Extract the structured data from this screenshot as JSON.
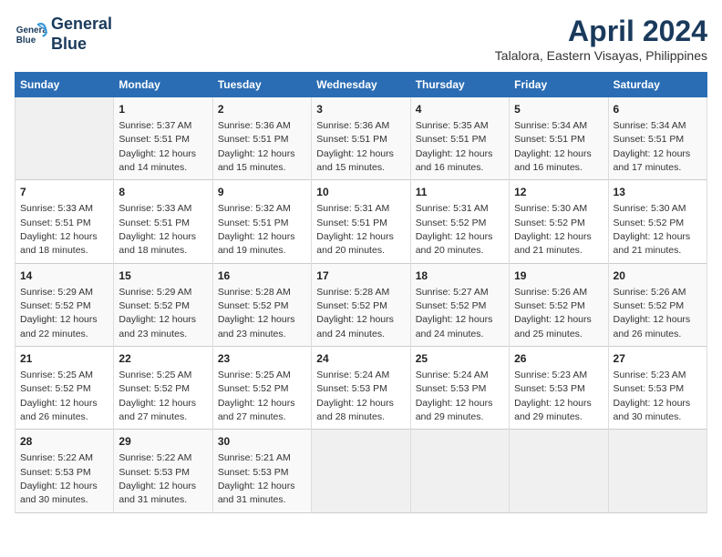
{
  "header": {
    "logo_line1": "General",
    "logo_line2": "Blue",
    "title": "April 2024",
    "subtitle": "Talalora, Eastern Visayas, Philippines"
  },
  "days_of_week": [
    "Sunday",
    "Monday",
    "Tuesday",
    "Wednesday",
    "Thursday",
    "Friday",
    "Saturday"
  ],
  "weeks": [
    [
      {
        "day": "",
        "info": ""
      },
      {
        "day": "1",
        "info": "Sunrise: 5:37 AM\nSunset: 5:51 PM\nDaylight: 12 hours\nand 14 minutes."
      },
      {
        "day": "2",
        "info": "Sunrise: 5:36 AM\nSunset: 5:51 PM\nDaylight: 12 hours\nand 15 minutes."
      },
      {
        "day": "3",
        "info": "Sunrise: 5:36 AM\nSunset: 5:51 PM\nDaylight: 12 hours\nand 15 minutes."
      },
      {
        "day": "4",
        "info": "Sunrise: 5:35 AM\nSunset: 5:51 PM\nDaylight: 12 hours\nand 16 minutes."
      },
      {
        "day": "5",
        "info": "Sunrise: 5:34 AM\nSunset: 5:51 PM\nDaylight: 12 hours\nand 16 minutes."
      },
      {
        "day": "6",
        "info": "Sunrise: 5:34 AM\nSunset: 5:51 PM\nDaylight: 12 hours\nand 17 minutes."
      }
    ],
    [
      {
        "day": "7",
        "info": "Sunrise: 5:33 AM\nSunset: 5:51 PM\nDaylight: 12 hours\nand 18 minutes."
      },
      {
        "day": "8",
        "info": "Sunrise: 5:33 AM\nSunset: 5:51 PM\nDaylight: 12 hours\nand 18 minutes."
      },
      {
        "day": "9",
        "info": "Sunrise: 5:32 AM\nSunset: 5:51 PM\nDaylight: 12 hours\nand 19 minutes."
      },
      {
        "day": "10",
        "info": "Sunrise: 5:31 AM\nSunset: 5:51 PM\nDaylight: 12 hours\nand 20 minutes."
      },
      {
        "day": "11",
        "info": "Sunrise: 5:31 AM\nSunset: 5:52 PM\nDaylight: 12 hours\nand 20 minutes."
      },
      {
        "day": "12",
        "info": "Sunrise: 5:30 AM\nSunset: 5:52 PM\nDaylight: 12 hours\nand 21 minutes."
      },
      {
        "day": "13",
        "info": "Sunrise: 5:30 AM\nSunset: 5:52 PM\nDaylight: 12 hours\nand 21 minutes."
      }
    ],
    [
      {
        "day": "14",
        "info": "Sunrise: 5:29 AM\nSunset: 5:52 PM\nDaylight: 12 hours\nand 22 minutes."
      },
      {
        "day": "15",
        "info": "Sunrise: 5:29 AM\nSunset: 5:52 PM\nDaylight: 12 hours\nand 23 minutes."
      },
      {
        "day": "16",
        "info": "Sunrise: 5:28 AM\nSunset: 5:52 PM\nDaylight: 12 hours\nand 23 minutes."
      },
      {
        "day": "17",
        "info": "Sunrise: 5:28 AM\nSunset: 5:52 PM\nDaylight: 12 hours\nand 24 minutes."
      },
      {
        "day": "18",
        "info": "Sunrise: 5:27 AM\nSunset: 5:52 PM\nDaylight: 12 hours\nand 24 minutes."
      },
      {
        "day": "19",
        "info": "Sunrise: 5:26 AM\nSunset: 5:52 PM\nDaylight: 12 hours\nand 25 minutes."
      },
      {
        "day": "20",
        "info": "Sunrise: 5:26 AM\nSunset: 5:52 PM\nDaylight: 12 hours\nand 26 minutes."
      }
    ],
    [
      {
        "day": "21",
        "info": "Sunrise: 5:25 AM\nSunset: 5:52 PM\nDaylight: 12 hours\nand 26 minutes."
      },
      {
        "day": "22",
        "info": "Sunrise: 5:25 AM\nSunset: 5:52 PM\nDaylight: 12 hours\nand 27 minutes."
      },
      {
        "day": "23",
        "info": "Sunrise: 5:25 AM\nSunset: 5:52 PM\nDaylight: 12 hours\nand 27 minutes."
      },
      {
        "day": "24",
        "info": "Sunrise: 5:24 AM\nSunset: 5:53 PM\nDaylight: 12 hours\nand 28 minutes."
      },
      {
        "day": "25",
        "info": "Sunrise: 5:24 AM\nSunset: 5:53 PM\nDaylight: 12 hours\nand 29 minutes."
      },
      {
        "day": "26",
        "info": "Sunrise: 5:23 AM\nSunset: 5:53 PM\nDaylight: 12 hours\nand 29 minutes."
      },
      {
        "day": "27",
        "info": "Sunrise: 5:23 AM\nSunset: 5:53 PM\nDaylight: 12 hours\nand 30 minutes."
      }
    ],
    [
      {
        "day": "28",
        "info": "Sunrise: 5:22 AM\nSunset: 5:53 PM\nDaylight: 12 hours\nand 30 minutes."
      },
      {
        "day": "29",
        "info": "Sunrise: 5:22 AM\nSunset: 5:53 PM\nDaylight: 12 hours\nand 31 minutes."
      },
      {
        "day": "30",
        "info": "Sunrise: 5:21 AM\nSunset: 5:53 PM\nDaylight: 12 hours\nand 31 minutes."
      },
      {
        "day": "",
        "info": ""
      },
      {
        "day": "",
        "info": ""
      },
      {
        "day": "",
        "info": ""
      },
      {
        "day": "",
        "info": ""
      }
    ]
  ]
}
